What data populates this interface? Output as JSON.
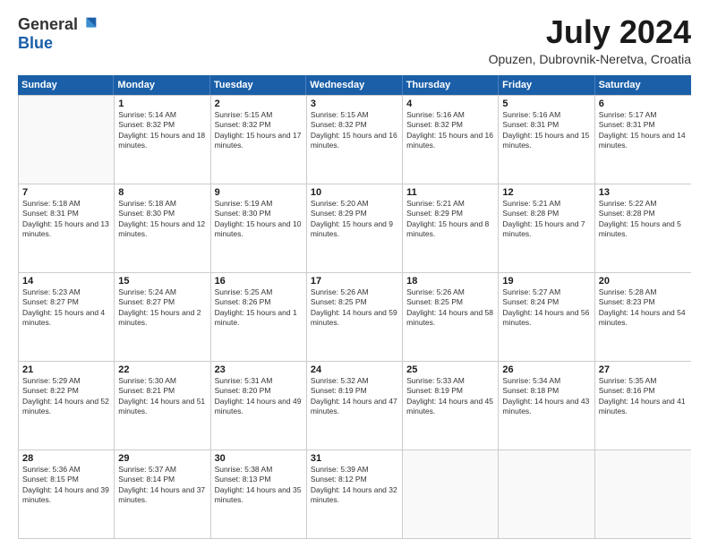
{
  "logo": {
    "general": "General",
    "blue": "Blue"
  },
  "title": "July 2024",
  "location": "Opuzen, Dubrovnik-Neretva, Croatia",
  "days_of_week": [
    "Sunday",
    "Monday",
    "Tuesday",
    "Wednesday",
    "Thursday",
    "Friday",
    "Saturday"
  ],
  "weeks": [
    [
      {
        "day": "",
        "empty": true
      },
      {
        "day": "1",
        "sunrise": "Sunrise: 5:14 AM",
        "sunset": "Sunset: 8:32 PM",
        "daylight": "Daylight: 15 hours and 18 minutes."
      },
      {
        "day": "2",
        "sunrise": "Sunrise: 5:15 AM",
        "sunset": "Sunset: 8:32 PM",
        "daylight": "Daylight: 15 hours and 17 minutes."
      },
      {
        "day": "3",
        "sunrise": "Sunrise: 5:15 AM",
        "sunset": "Sunset: 8:32 PM",
        "daylight": "Daylight: 15 hours and 16 minutes."
      },
      {
        "day": "4",
        "sunrise": "Sunrise: 5:16 AM",
        "sunset": "Sunset: 8:32 PM",
        "daylight": "Daylight: 15 hours and 16 minutes."
      },
      {
        "day": "5",
        "sunrise": "Sunrise: 5:16 AM",
        "sunset": "Sunset: 8:31 PM",
        "daylight": "Daylight: 15 hours and 15 minutes."
      },
      {
        "day": "6",
        "sunrise": "Sunrise: 5:17 AM",
        "sunset": "Sunset: 8:31 PM",
        "daylight": "Daylight: 15 hours and 14 minutes."
      }
    ],
    [
      {
        "day": "7",
        "sunrise": "Sunrise: 5:18 AM",
        "sunset": "Sunset: 8:31 PM",
        "daylight": "Daylight: 15 hours and 13 minutes."
      },
      {
        "day": "8",
        "sunrise": "Sunrise: 5:18 AM",
        "sunset": "Sunset: 8:30 PM",
        "daylight": "Daylight: 15 hours and 12 minutes."
      },
      {
        "day": "9",
        "sunrise": "Sunrise: 5:19 AM",
        "sunset": "Sunset: 8:30 PM",
        "daylight": "Daylight: 15 hours and 10 minutes."
      },
      {
        "day": "10",
        "sunrise": "Sunrise: 5:20 AM",
        "sunset": "Sunset: 8:29 PM",
        "daylight": "Daylight: 15 hours and 9 minutes."
      },
      {
        "day": "11",
        "sunrise": "Sunrise: 5:21 AM",
        "sunset": "Sunset: 8:29 PM",
        "daylight": "Daylight: 15 hours and 8 minutes."
      },
      {
        "day": "12",
        "sunrise": "Sunrise: 5:21 AM",
        "sunset": "Sunset: 8:28 PM",
        "daylight": "Daylight: 15 hours and 7 minutes."
      },
      {
        "day": "13",
        "sunrise": "Sunrise: 5:22 AM",
        "sunset": "Sunset: 8:28 PM",
        "daylight": "Daylight: 15 hours and 5 minutes."
      }
    ],
    [
      {
        "day": "14",
        "sunrise": "Sunrise: 5:23 AM",
        "sunset": "Sunset: 8:27 PM",
        "daylight": "Daylight: 15 hours and 4 minutes."
      },
      {
        "day": "15",
        "sunrise": "Sunrise: 5:24 AM",
        "sunset": "Sunset: 8:27 PM",
        "daylight": "Daylight: 15 hours and 2 minutes."
      },
      {
        "day": "16",
        "sunrise": "Sunrise: 5:25 AM",
        "sunset": "Sunset: 8:26 PM",
        "daylight": "Daylight: 15 hours and 1 minute."
      },
      {
        "day": "17",
        "sunrise": "Sunrise: 5:26 AM",
        "sunset": "Sunset: 8:25 PM",
        "daylight": "Daylight: 14 hours and 59 minutes."
      },
      {
        "day": "18",
        "sunrise": "Sunrise: 5:26 AM",
        "sunset": "Sunset: 8:25 PM",
        "daylight": "Daylight: 14 hours and 58 minutes."
      },
      {
        "day": "19",
        "sunrise": "Sunrise: 5:27 AM",
        "sunset": "Sunset: 8:24 PM",
        "daylight": "Daylight: 14 hours and 56 minutes."
      },
      {
        "day": "20",
        "sunrise": "Sunrise: 5:28 AM",
        "sunset": "Sunset: 8:23 PM",
        "daylight": "Daylight: 14 hours and 54 minutes."
      }
    ],
    [
      {
        "day": "21",
        "sunrise": "Sunrise: 5:29 AM",
        "sunset": "Sunset: 8:22 PM",
        "daylight": "Daylight: 14 hours and 52 minutes."
      },
      {
        "day": "22",
        "sunrise": "Sunrise: 5:30 AM",
        "sunset": "Sunset: 8:21 PM",
        "daylight": "Daylight: 14 hours and 51 minutes."
      },
      {
        "day": "23",
        "sunrise": "Sunrise: 5:31 AM",
        "sunset": "Sunset: 8:20 PM",
        "daylight": "Daylight: 14 hours and 49 minutes."
      },
      {
        "day": "24",
        "sunrise": "Sunrise: 5:32 AM",
        "sunset": "Sunset: 8:19 PM",
        "daylight": "Daylight: 14 hours and 47 minutes."
      },
      {
        "day": "25",
        "sunrise": "Sunrise: 5:33 AM",
        "sunset": "Sunset: 8:19 PM",
        "daylight": "Daylight: 14 hours and 45 minutes."
      },
      {
        "day": "26",
        "sunrise": "Sunrise: 5:34 AM",
        "sunset": "Sunset: 8:18 PM",
        "daylight": "Daylight: 14 hours and 43 minutes."
      },
      {
        "day": "27",
        "sunrise": "Sunrise: 5:35 AM",
        "sunset": "Sunset: 8:16 PM",
        "daylight": "Daylight: 14 hours and 41 minutes."
      }
    ],
    [
      {
        "day": "28",
        "sunrise": "Sunrise: 5:36 AM",
        "sunset": "Sunset: 8:15 PM",
        "daylight": "Daylight: 14 hours and 39 minutes."
      },
      {
        "day": "29",
        "sunrise": "Sunrise: 5:37 AM",
        "sunset": "Sunset: 8:14 PM",
        "daylight": "Daylight: 14 hours and 37 minutes."
      },
      {
        "day": "30",
        "sunrise": "Sunrise: 5:38 AM",
        "sunset": "Sunset: 8:13 PM",
        "daylight": "Daylight: 14 hours and 35 minutes."
      },
      {
        "day": "31",
        "sunrise": "Sunrise: 5:39 AM",
        "sunset": "Sunset: 8:12 PM",
        "daylight": "Daylight: 14 hours and 32 minutes."
      },
      {
        "day": "",
        "empty": true
      },
      {
        "day": "",
        "empty": true
      },
      {
        "day": "",
        "empty": true
      }
    ]
  ]
}
